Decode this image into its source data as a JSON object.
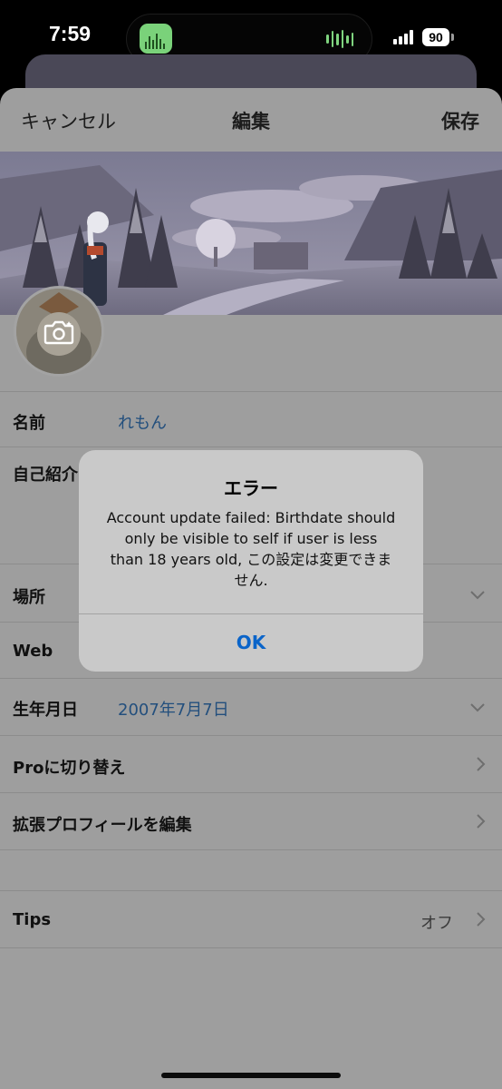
{
  "status_bar": {
    "time": "7:59",
    "battery": "90",
    "battery_icon": "battery-icon",
    "signal_icon": "cellular-signal-icon"
  },
  "nav": {
    "cancel_label": "キャンセル",
    "title": "編集",
    "save_label": "保存"
  },
  "profile": {
    "avatar_icon": "camera-icon"
  },
  "fields": {
    "name": {
      "label": "名前",
      "value": "れもん"
    },
    "bio": {
      "label": "自己紹介"
    },
    "location": {
      "label": "場所"
    },
    "website": {
      "label": "Web"
    },
    "birthdate": {
      "label": "生年月日",
      "value": "2007年7月7日"
    },
    "switch_pro": {
      "label": "Proに切り替え"
    },
    "extended_profile": {
      "label": "拡張プロフィールを編集"
    },
    "tips": {
      "label": "Tips",
      "value": "オフ"
    }
  },
  "alert": {
    "title": "エラー",
    "message": "Account update failed: Birthdate should only be visible to self if user is less than 18 years old, この設定は変更できません.",
    "ok_label": "OK",
    "ok_color": "#0a64c9"
  },
  "colors": {
    "link_value": "#234f7d",
    "sheet_dimmed": "#9e9e9e"
  }
}
